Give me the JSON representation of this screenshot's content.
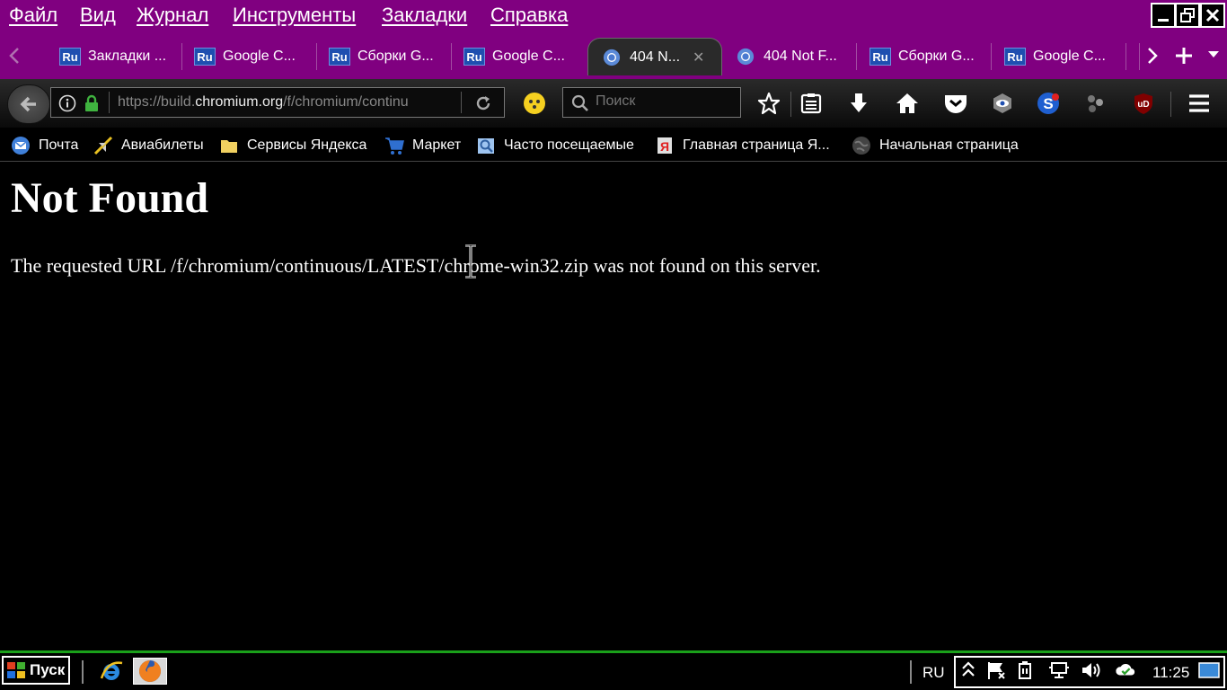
{
  "menu": {
    "items": [
      "Файл",
      "Вид",
      "Журнал",
      "Инструменты",
      "Закладки",
      "Справка"
    ]
  },
  "tabs": [
    {
      "title": "Закладки ...",
      "icon": "ru-icon"
    },
    {
      "title": "Google C...",
      "icon": "ru-icon"
    },
    {
      "title": "Сборки G...",
      "icon": "ru-icon"
    },
    {
      "title": "Google C...",
      "icon": "ru-icon"
    },
    {
      "title": "404 N...",
      "icon": "chromium-icon",
      "active": true
    },
    {
      "title": "404 Not F...",
      "icon": "chromium-icon"
    },
    {
      "title": "Сборки G...",
      "icon": "ru-icon"
    },
    {
      "title": "Google C...",
      "icon": "ru-icon"
    }
  ],
  "navbar": {
    "url_prefix": "https://build.",
    "url_domain": "chromium.org",
    "url_path": "/f/chromium/continu",
    "search_placeholder": "Поиск"
  },
  "bookmarks": [
    {
      "label": "Почта",
      "icon": "mail-icon"
    },
    {
      "label": "Авиабилеты",
      "icon": "plane-icon"
    },
    {
      "label": "Сервисы Яндекса",
      "icon": "folder-icon"
    },
    {
      "label": "Маркет",
      "icon": "cart-icon"
    },
    {
      "label": "Часто посещаемые",
      "icon": "search-folder-icon"
    },
    {
      "label": "Главная страница Я...",
      "icon": "yandex-icon"
    },
    {
      "label": "Начальная страница",
      "icon": "globe-icon"
    }
  ],
  "page": {
    "heading": "Not Found",
    "message": "The requested URL /f/chromium/continuous/LATEST/chrome-win32.zip was not found on this server."
  },
  "taskbar": {
    "start_label": "Пуск",
    "language": "RU",
    "clock": "11:25"
  },
  "colors": {
    "menubar_bg": "#800080",
    "taskbar_border": "#1aa01a",
    "ru_icon_bg": "#1f4fb0"
  }
}
